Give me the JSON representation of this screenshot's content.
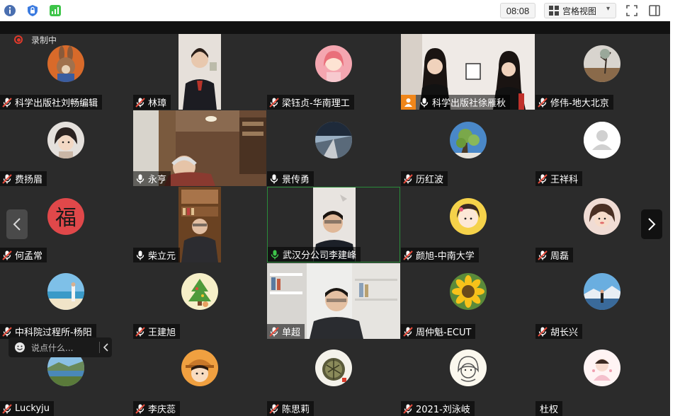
{
  "toolbar": {
    "timer": "08:08",
    "view_label": "宫格视图"
  },
  "recording": {
    "label": "录制中"
  },
  "chat": {
    "placeholder": "说点什么..."
  },
  "colors": {
    "mic_red": "#e74c3c",
    "mic_green": "#3ec54a",
    "tile_bg": "#2b2b2b",
    "active_border": "#2a8c3a"
  },
  "participants": [
    {
      "name": "科学出版社刘畅编辑"
    },
    {
      "name": "林璋"
    },
    {
      "name": "梁钰贞-华南理工"
    },
    {
      "name": "科学出版社徐雁秋"
    },
    {
      "name": "修伟-地大北京"
    },
    {
      "name": "费扬眉"
    },
    {
      "name": "永亨"
    },
    {
      "name": "景传勇"
    },
    {
      "name": "历红波"
    },
    {
      "name": "王祥科"
    },
    {
      "name": "何孟常"
    },
    {
      "name": "柴立元"
    },
    {
      "name": "武汉分公司李建峰"
    },
    {
      "name": "颜旭-中南大学"
    },
    {
      "name": "周磊"
    },
    {
      "name": "中科院过程所-杨阳"
    },
    {
      "name": "王建旭"
    },
    {
      "name": "单超"
    },
    {
      "name": "周仲魁-ECUT"
    },
    {
      "name": "胡长兴"
    },
    {
      "name": "Luckyju"
    },
    {
      "name": "李庆蕊"
    },
    {
      "name": "陈思莉"
    },
    {
      "name": "2021-刘泳岐"
    },
    {
      "name": "杜权"
    }
  ],
  "avatar_badges": {
    "fu_char": "福"
  }
}
